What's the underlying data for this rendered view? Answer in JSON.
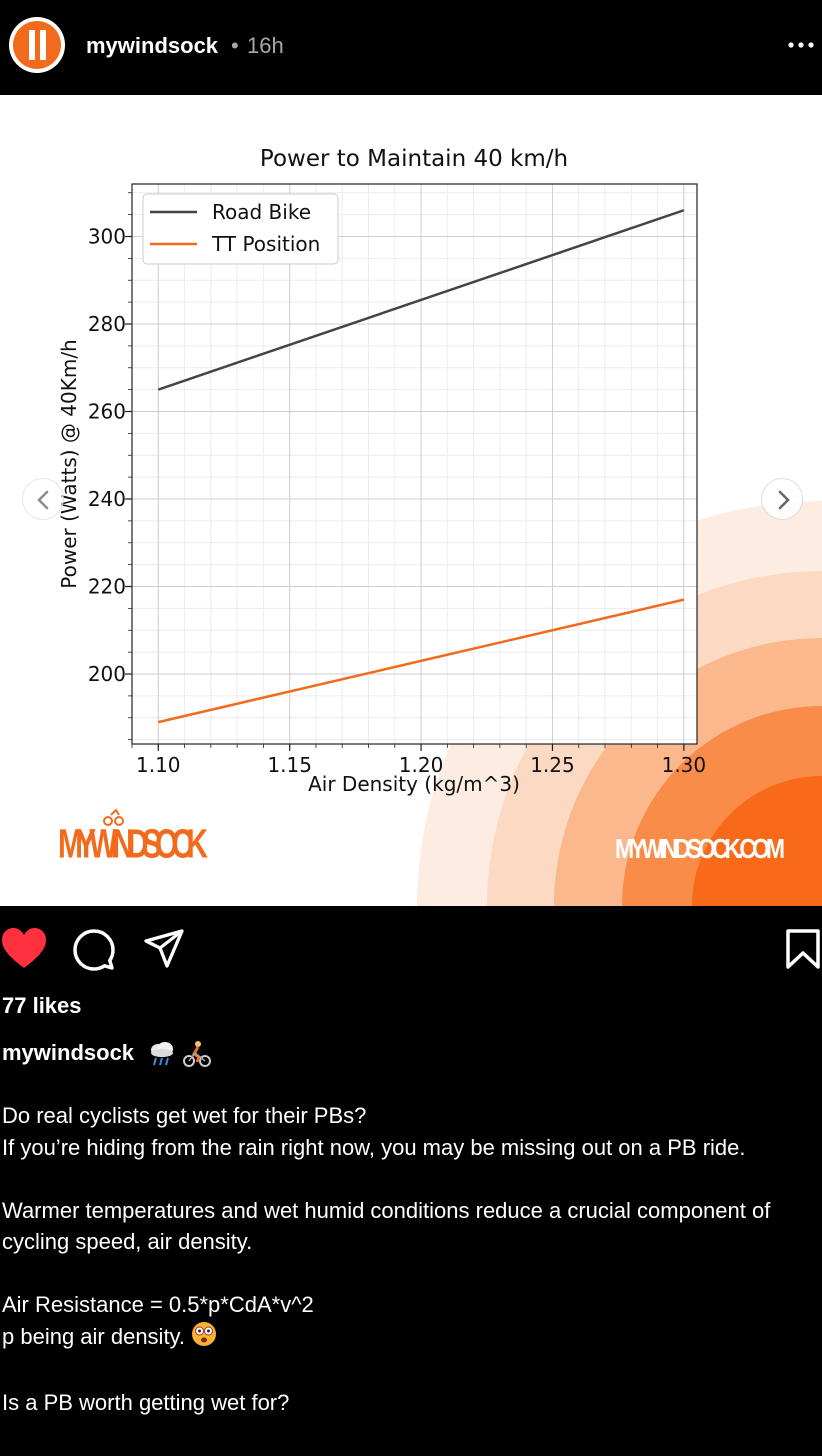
{
  "post": {
    "username": "mywindsock",
    "separator": "•",
    "time": "16h"
  },
  "chart_data": {
    "type": "line",
    "title": "Power to Maintain 40 km/h",
    "xlabel": "Air Density (kg/m^3)",
    "ylabel": "Power (Watts) @ 40Km/h",
    "xlim": [
      1.09,
      1.305
    ],
    "ylim": [
      184,
      312
    ],
    "xticks": [
      "1.10",
      "1.15",
      "1.20",
      "1.25",
      "1.30"
    ],
    "yticks": [
      "200",
      "220",
      "240",
      "260",
      "280",
      "300"
    ],
    "grid": true,
    "legend_position": "top-left",
    "series": [
      {
        "name": "Road Bike",
        "color": "#444444",
        "x": [
          1.1,
          1.3
        ],
        "y": [
          265,
          306
        ]
      },
      {
        "name": "TT Position",
        "color": "#f26a1b",
        "x": [
          1.1,
          1.3
        ],
        "y": [
          189,
          217
        ]
      }
    ]
  },
  "branding": {
    "logo_text": "MYWINDSOCK",
    "website": "MYWINDSOCK.COM",
    "accent": "#f26a1b"
  },
  "icons": {
    "like": "heart-icon",
    "comment": "comment-icon",
    "share": "share-icon",
    "save": "bookmark-icon",
    "more": "more-icon"
  },
  "engagement": {
    "likes": "77 likes"
  },
  "caption": {
    "username": "mywindsock",
    "lines": [
      "Do real cyclists get wet for their PBs?",
      "If you’re hiding from the rain right now, you may be missing out on a PB ride.",
      "",
      "Warmer temperatures and wet humid conditions reduce a crucial component of cycling speed, air density.",
      "",
      "Air Resistance = 0.5*p*CdA*v^2",
      "p being air density.",
      "",
      "Is a PB worth getting wet for?"
    ]
  }
}
